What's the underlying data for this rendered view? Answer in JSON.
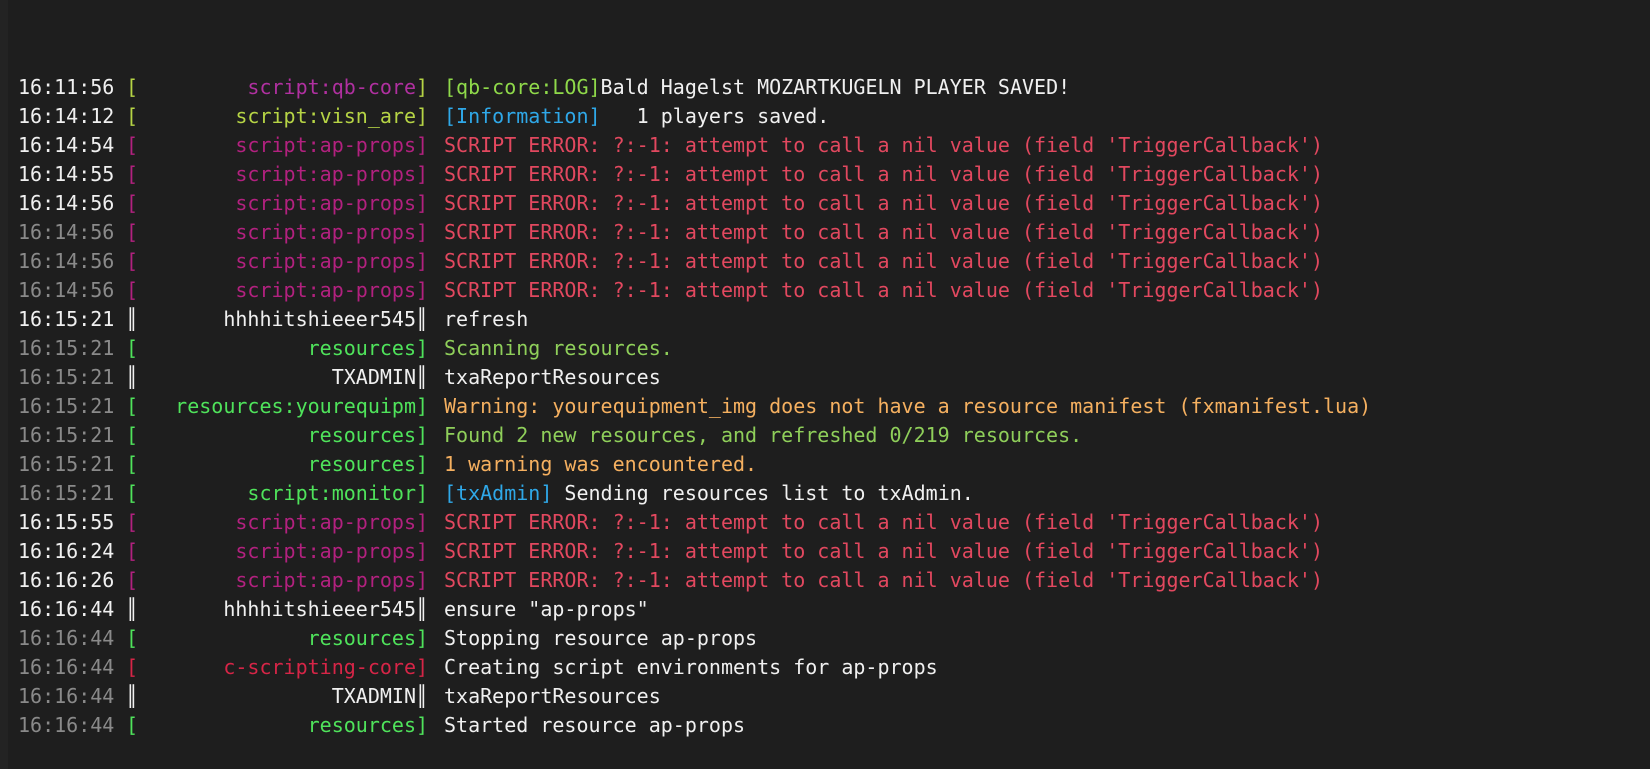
{
  "colors": {
    "qbcore": "#b6d445",
    "visn": "#b6d445",
    "approps": "#b2217f",
    "resources": "#4fe35b",
    "resources_warn": "#f0a040",
    "scripting_core": "#d62547",
    "monitor": "#4fe35b",
    "user": "#f0f0f0",
    "error_msg": "#e2485f",
    "info_msg": "#f0f0f0",
    "success_msg": "#8fcf5a",
    "warn_msg": "#f5b060",
    "tag_info": "#2fa8e8",
    "tag_log": "#8fd94a"
  },
  "rows": [
    {
      "time": "16:11:56",
      "dim": false,
      "open": "[",
      "close": "]",
      "channel": "script:qb-core",
      "chColor": "#b030a0",
      "brColor": "#b6d445",
      "tag": "[qb-core:LOG]",
      "tagColor": "#8fd94a",
      "msg": "Bald Hagelst MOZARTKUGELN PLAYER SAVED!",
      "msgColor": "#f0f0f0"
    },
    {
      "time": "16:14:12",
      "dim": false,
      "open": "[",
      "close": "]",
      "channel": "script:visn_are",
      "chColor": "#b6d445",
      "brColor": "#b6d445",
      "tag": "[Information]",
      "tagColor": "#2fa8e8",
      "msg": "   1 players saved.",
      "msgColor": "#f0f0f0"
    },
    {
      "time": "16:14:54",
      "dim": false,
      "open": "[",
      "close": "]",
      "channel": "script:ap-props",
      "chColor": "#b2217f",
      "brColor": "#b2217f",
      "tag": "",
      "tagColor": "",
      "msg": "SCRIPT ERROR: ?:-1: attempt to call a nil value (field 'TriggerCallback')",
      "msgColor": "#e2485f"
    },
    {
      "time": "16:14:55",
      "dim": false,
      "open": "[",
      "close": "]",
      "channel": "script:ap-props",
      "chColor": "#b2217f",
      "brColor": "#b2217f",
      "tag": "",
      "tagColor": "",
      "msg": "SCRIPT ERROR: ?:-1: attempt to call a nil value (field 'TriggerCallback')",
      "msgColor": "#e2485f"
    },
    {
      "time": "16:14:56",
      "dim": false,
      "open": "[",
      "close": "]",
      "channel": "script:ap-props",
      "chColor": "#b2217f",
      "brColor": "#b2217f",
      "tag": "",
      "tagColor": "",
      "msg": "SCRIPT ERROR: ?:-1: attempt to call a nil value (field 'TriggerCallback')",
      "msgColor": "#e2485f"
    },
    {
      "time": "16:14:56",
      "dim": true,
      "open": "[",
      "close": "]",
      "channel": "script:ap-props",
      "chColor": "#b2217f",
      "brColor": "#b2217f",
      "tag": "",
      "tagColor": "",
      "msg": "SCRIPT ERROR: ?:-1: attempt to call a nil value (field 'TriggerCallback')",
      "msgColor": "#e2485f"
    },
    {
      "time": "16:14:56",
      "dim": true,
      "open": "[",
      "close": "]",
      "channel": "script:ap-props",
      "chColor": "#b2217f",
      "brColor": "#b2217f",
      "tag": "",
      "tagColor": "",
      "msg": "SCRIPT ERROR: ?:-1: attempt to call a nil value (field 'TriggerCallback')",
      "msgColor": "#e2485f"
    },
    {
      "time": "16:14:56",
      "dim": true,
      "open": "[",
      "close": "]",
      "channel": "script:ap-props",
      "chColor": "#b2217f",
      "brColor": "#b2217f",
      "tag": "",
      "tagColor": "",
      "msg": "SCRIPT ERROR: ?:-1: attempt to call a nil value (field 'TriggerCallback')",
      "msgColor": "#e2485f"
    },
    {
      "time": "16:15:21",
      "dim": false,
      "open": "║",
      "close": "║",
      "channel": "hhhhitshieeer545",
      "chColor": "#f0f0f0",
      "brColor": "#f0f0f0",
      "tag": "",
      "tagColor": "",
      "msg": "refresh",
      "msgColor": "#f0f0f0"
    },
    {
      "time": "16:15:21",
      "dim": true,
      "open": "[",
      "close": "]",
      "channel": "resources",
      "chColor": "#4fe35b",
      "brColor": "#4fe35b",
      "tag": "",
      "tagColor": "",
      "msg": "Scanning resources.",
      "msgColor": "#8fcf5a"
    },
    {
      "time": "16:15:21",
      "dim": true,
      "open": "║",
      "close": "║",
      "channel": "TXADMIN",
      "chColor": "#f0f0f0",
      "brColor": "#f0f0f0",
      "tag": "",
      "tagColor": "",
      "msg": "txaReportResources",
      "msgColor": "#f0f0f0"
    },
    {
      "time": "16:15:21",
      "dim": true,
      "open": "[",
      "close": "]",
      "channel": "resources:yourequipm",
      "chColor": "#4fe35b",
      "brColor": "#4fe35b",
      "tag": "",
      "tagColor": "",
      "msg": "Warning: yourequipment_img does not have a resource manifest (fxmanifest.lua)",
      "msgColor": "#f5b060"
    },
    {
      "time": "16:15:21",
      "dim": true,
      "open": "[",
      "close": "]",
      "channel": "resources",
      "chColor": "#4fe35b",
      "brColor": "#4fe35b",
      "tag": "",
      "tagColor": "",
      "msg": "Found 2 new resources, and refreshed 0/219 resources.",
      "msgColor": "#8fcf5a"
    },
    {
      "time": "16:15:21",
      "dim": true,
      "open": "[",
      "close": "]",
      "channel": "resources",
      "chColor": "#4fe35b",
      "brColor": "#4fe35b",
      "tag": "",
      "tagColor": "",
      "msg": "1 warning was encountered.",
      "msgColor": "#f5b060"
    },
    {
      "time": "16:15:21",
      "dim": true,
      "open": "[",
      "close": "]",
      "channel": "script:monitor",
      "chColor": "#4fe35b",
      "brColor": "#4fe35b",
      "tag": "[txAdmin]",
      "tagColor": "#2fa8e8",
      "msg": " Sending resources list to txAdmin.",
      "msgColor": "#f0f0f0"
    },
    {
      "time": "16:15:55",
      "dim": false,
      "open": "[",
      "close": "]",
      "channel": "script:ap-props",
      "chColor": "#b2217f",
      "brColor": "#b2217f",
      "tag": "",
      "tagColor": "",
      "msg": "SCRIPT ERROR: ?:-1: attempt to call a nil value (field 'TriggerCallback')",
      "msgColor": "#e2485f"
    },
    {
      "time": "16:16:24",
      "dim": false,
      "open": "[",
      "close": "]",
      "channel": "script:ap-props",
      "chColor": "#b2217f",
      "brColor": "#b2217f",
      "tag": "",
      "tagColor": "",
      "msg": "SCRIPT ERROR: ?:-1: attempt to call a nil value (field 'TriggerCallback')",
      "msgColor": "#e2485f"
    },
    {
      "time": "16:16:26",
      "dim": false,
      "open": "[",
      "close": "]",
      "channel": "script:ap-props",
      "chColor": "#b2217f",
      "brColor": "#b2217f",
      "tag": "",
      "tagColor": "",
      "msg": "SCRIPT ERROR: ?:-1: attempt to call a nil value (field 'TriggerCallback')",
      "msgColor": "#e2485f"
    },
    {
      "time": "16:16:44",
      "dim": false,
      "open": "║",
      "close": "║",
      "channel": "hhhhitshieeer545",
      "chColor": "#f0f0f0",
      "brColor": "#f0f0f0",
      "tag": "",
      "tagColor": "",
      "msg": "ensure \"ap-props\"",
      "msgColor": "#f0f0f0"
    },
    {
      "time": "16:16:44",
      "dim": true,
      "open": "[",
      "close": "]",
      "channel": "resources",
      "chColor": "#4fe35b",
      "brColor": "#4fe35b",
      "tag": "",
      "tagColor": "",
      "msg": "Stopping resource ap-props",
      "msgColor": "#f0f0f0"
    },
    {
      "time": "16:16:44",
      "dim": true,
      "open": "[",
      "close": "]",
      "channel": "c-scripting-core",
      "chColor": "#d62547",
      "brColor": "#d62547",
      "tag": "",
      "tagColor": "",
      "msg": "Creating script environments for ap-props",
      "msgColor": "#f0f0f0"
    },
    {
      "time": "16:16:44",
      "dim": true,
      "open": "║",
      "close": "║",
      "channel": "TXADMIN",
      "chColor": "#f0f0f0",
      "brColor": "#f0f0f0",
      "tag": "",
      "tagColor": "",
      "msg": "txaReportResources",
      "msgColor": "#f0f0f0"
    },
    {
      "time": "16:16:44",
      "dim": true,
      "open": "[",
      "close": "]",
      "channel": "resources",
      "chColor": "#4fe35b",
      "brColor": "#4fe35b",
      "tag": "",
      "tagColor": "",
      "msg": "Started resource ap-props",
      "msgColor": "#f0f0f0"
    }
  ]
}
